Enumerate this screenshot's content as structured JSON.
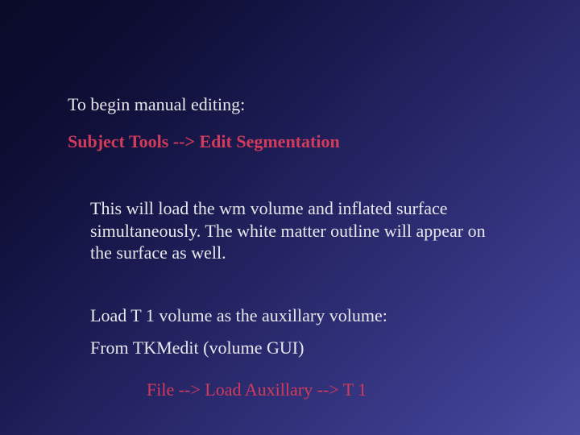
{
  "slide": {
    "intro": "To begin manual editing:",
    "menu_path": "Subject Tools --> Edit Segmentation",
    "body": "This will load the wm volume and inflated surface simultaneously.  The white matter outline will appear on the surface as well.",
    "load_instruction": "Load T 1 volume as the auxillary volume:",
    "from_line": "From TKMedit (volume GUI)",
    "file_path": "File --> Load Auxillary --> T 1"
  },
  "colors": {
    "text": "#e8e8ec",
    "accent": "#d33b5a"
  }
}
